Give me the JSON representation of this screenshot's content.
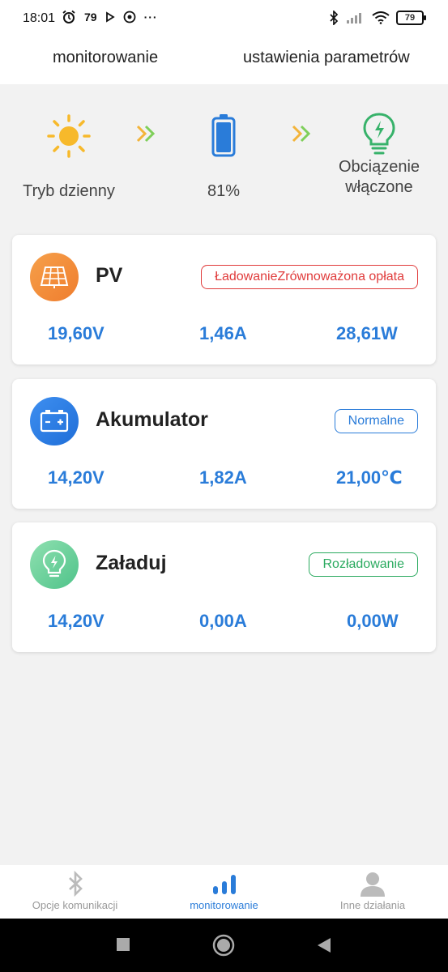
{
  "status_bar": {
    "time": "18:01",
    "notif_count": "79",
    "battery": "79"
  },
  "top_tabs": [
    "monitorowanie",
    "ustawienia parametrów"
  ],
  "flow": {
    "mode_label": "Tryb dzienny",
    "battery_percent": "81%",
    "load_label_line1": "Obciązenie",
    "load_label_line2": "włączone",
    "sun_color": "#f7b92b",
    "arrow_colors": [
      "#f3b43a",
      "#7fcf5a"
    ],
    "battery_color": "#2a7cd9",
    "bulb_color": "#37b26a"
  },
  "cards": {
    "pv": {
      "title": "PV",
      "status": "ŁadowanieZrównoważona opłata",
      "status_color": "#e03b3b",
      "values": [
        "19,60V",
        "1,46A",
        "28,61W"
      ],
      "icon_gradient": [
        "#f6a04a",
        "#ef7d2e"
      ]
    },
    "battery": {
      "title": "Akumulator",
      "status": "Normalne",
      "status_color": "#2a7cd9",
      "values": [
        "14,20V",
        "1,82A",
        "21,00℃"
      ],
      "icon_gradient": [
        "#3e8ff0",
        "#1f6ed8"
      ]
    },
    "load": {
      "title": "Załaduj",
      "status": "Rozładowanie",
      "status_color": "#2aaa5f",
      "values": [
        "14,20V",
        "0,00A",
        "0,00W"
      ],
      "icon_gradient": [
        "#8fe0b0",
        "#4fc38a"
      ]
    }
  },
  "bottom_nav": [
    {
      "label": "Opcje komunikacji",
      "icon": "bluetooth-icon"
    },
    {
      "label": "monitorowanie",
      "icon": "bar-chart-icon",
      "active": true
    },
    {
      "label": "Inne działania",
      "icon": "person-icon"
    }
  ],
  "accent": "#2a7cd9"
}
